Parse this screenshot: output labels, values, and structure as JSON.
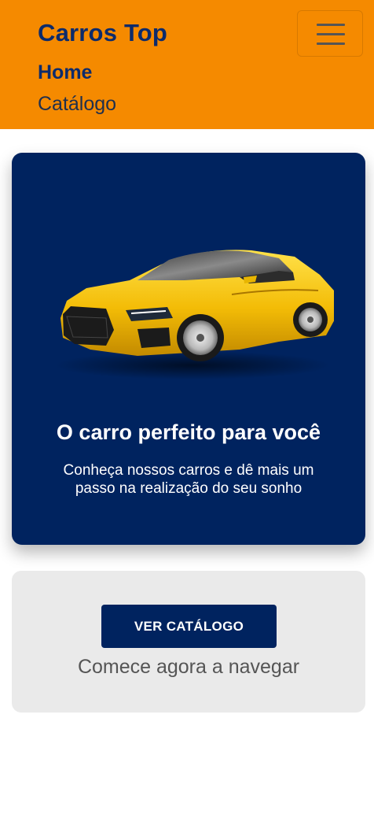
{
  "navbar": {
    "brand": "Carros Top",
    "toggle_icon": "hamburger-menu-icon",
    "links": [
      {
        "label": "Home",
        "active": true
      },
      {
        "label": "Catálogo",
        "active": false
      }
    ],
    "background_color": "#f58a00",
    "brand_color": "#0d2b6b"
  },
  "hero": {
    "image": "yellow-sports-car",
    "title": "O carro perfeito para você",
    "subtitle": "Conheça nossos carros e dê mais um passo na realização do seu sonho",
    "background_color": "#00235f"
  },
  "cta": {
    "button_label": "VER CATÁLOGO",
    "text": "Comece agora a navegar",
    "background_color": "#eaeaea"
  }
}
